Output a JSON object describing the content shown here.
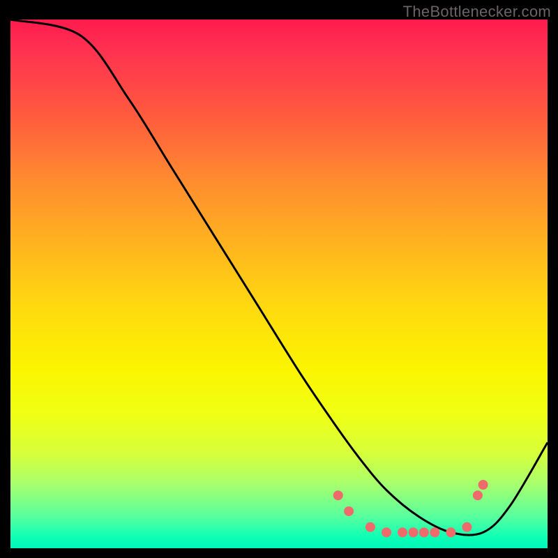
{
  "watermark": "TheBottlenecker.com",
  "chart_data": {
    "type": "line",
    "title": "",
    "xlabel": "",
    "ylabel": "",
    "xlim": [
      0,
      100
    ],
    "ylim": [
      0,
      100
    ],
    "series": [
      {
        "name": "bottleneck-curve",
        "color": "#000000",
        "x": [
          0,
          13,
          22,
          30,
          38,
          46,
          54,
          60,
          65,
          70,
          76,
          82,
          88,
          93,
          100
        ],
        "values": [
          100,
          97,
          85,
          72,
          59,
          46,
          33,
          24,
          17,
          11,
          6,
          3,
          3,
          8,
          20
        ]
      }
    ],
    "markers": {
      "name": "optimal-range",
      "color": "#ef6a6a",
      "radius": 7,
      "points": [
        {
          "x": 61,
          "y": 10
        },
        {
          "x": 63,
          "y": 7
        },
        {
          "x": 67,
          "y": 4
        },
        {
          "x": 70,
          "y": 3
        },
        {
          "x": 73,
          "y": 3
        },
        {
          "x": 75,
          "y": 3
        },
        {
          "x": 77,
          "y": 3
        },
        {
          "x": 79,
          "y": 3
        },
        {
          "x": 82,
          "y": 3
        },
        {
          "x": 85,
          "y": 4
        },
        {
          "x": 87,
          "y": 10
        },
        {
          "x": 88,
          "y": 12
        }
      ]
    }
  }
}
